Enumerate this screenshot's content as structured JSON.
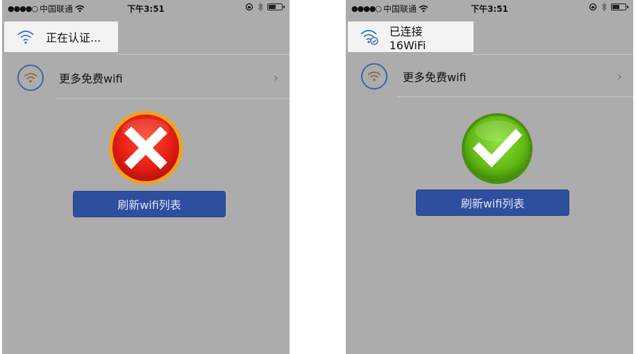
{
  "screens": [
    {
      "statusbar": {
        "signal_dots": "●●●●○",
        "carrier": "中国联通",
        "time": "下午3:51"
      },
      "toast": {
        "text": "正在认证..."
      },
      "more_wifi": {
        "label": "更多免费wifi",
        "chevron": "›"
      },
      "result": {
        "state": "failed",
        "icon": "red-x-icon"
      },
      "refresh_button": {
        "label": "刷新wifi列表"
      }
    },
    {
      "statusbar": {
        "signal_dots": "●●●●○",
        "carrier": "中国联通",
        "time": "下午3:51"
      },
      "toast": {
        "text": "已连接16WiFi"
      },
      "more_wifi": {
        "label": "更多免费wifi",
        "chevron": "›"
      },
      "result": {
        "state": "connected",
        "icon": "green-check-icon"
      },
      "refresh_button": {
        "label": "刷新wifi列表"
      }
    }
  ],
  "colors": {
    "background": "#acacac",
    "button": "#2e4f9f",
    "error": "#e02418",
    "success": "#6cc21a"
  }
}
